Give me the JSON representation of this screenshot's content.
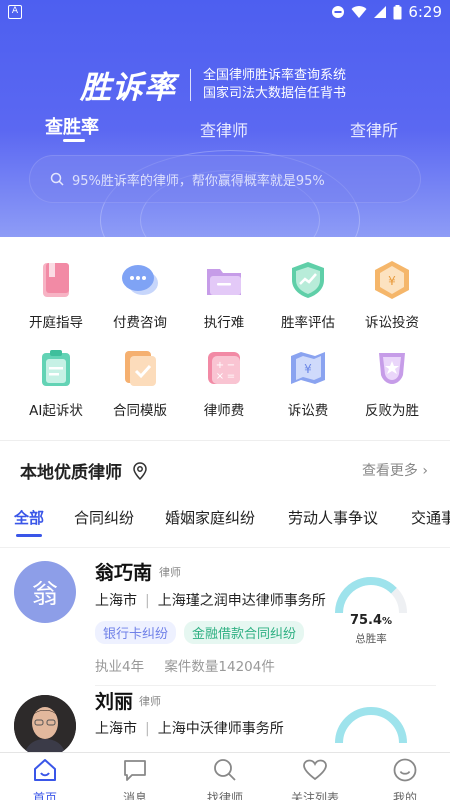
{
  "status": {
    "time": "6:29",
    "left_badge": "A"
  },
  "brand": {
    "logo": "胜诉率",
    "line1": "全国律师胜诉率查询系统",
    "line2": "国家司法大数据信任背书"
  },
  "hero_tabs": [
    "查胜率",
    "查律师",
    "查律所"
  ],
  "search": {
    "placeholder": "95%胜诉率的律师，帮你赢得概率就是95%"
  },
  "features": [
    {
      "label": "开庭指导",
      "icon": "book-icon",
      "color": "#f28aa5"
    },
    {
      "label": "付费咨询",
      "icon": "chat-bubble-icon",
      "color": "#7fa3f5"
    },
    {
      "label": "执行难",
      "icon": "folder-icon",
      "color": "#c69ce8"
    },
    {
      "label": "胜率评估",
      "icon": "shield-chart-icon",
      "color": "#5fcfa8"
    },
    {
      "label": "诉讼投资",
      "icon": "yuan-hexagon-icon",
      "color": "#f5b66a"
    },
    {
      "label": "AI起诉状",
      "icon": "clipboard-icon",
      "color": "#63d3b5"
    },
    {
      "label": "合同模版",
      "icon": "document-check-icon",
      "color": "#f5b070"
    },
    {
      "label": "律师费",
      "icon": "calculator-icon",
      "color": "#f28aa5"
    },
    {
      "label": "诉讼费",
      "icon": "yuan-map-icon",
      "color": "#8aa3f0"
    },
    {
      "label": "反败为胜",
      "icon": "trophy-icon",
      "color": "#c69ce8"
    }
  ],
  "section": {
    "title": "本地优质律师",
    "more": "查看更多"
  },
  "categories": [
    "全部",
    "合同纠纷",
    "婚姻家庭纠纷",
    "劳动人事争议",
    "交通事"
  ],
  "lawyers": [
    {
      "avatar_text": "翁",
      "name": "翁巧南",
      "tag": "律师",
      "city": "上海市",
      "firm": "上海瑾之润申达律师事务所",
      "badges": [
        "银行卡纠纷",
        "金融借款合同纠纷"
      ],
      "years": "执业4年",
      "cases": "案件数量14204件",
      "rate_value": "75.4",
      "rate_unit": "%",
      "rate": 0.754,
      "rate_label": "总胜率"
    },
    {
      "name": "刘丽",
      "tag": "律师",
      "city": "上海市",
      "firm": "上海中沃律师事务所"
    }
  ],
  "tabbar": [
    {
      "label": "首页",
      "icon": "home-icon"
    },
    {
      "label": "消息",
      "icon": "message-icon"
    },
    {
      "label": "找律师",
      "icon": "search-lawyer-icon"
    },
    {
      "label": "关注列表",
      "icon": "heart-icon"
    },
    {
      "label": "我的",
      "icon": "profile-smile-icon"
    }
  ],
  "colors": {
    "primary": "#3a56e8",
    "hero_start": "#4d5ff0",
    "gauge": "#9ee3ec"
  }
}
